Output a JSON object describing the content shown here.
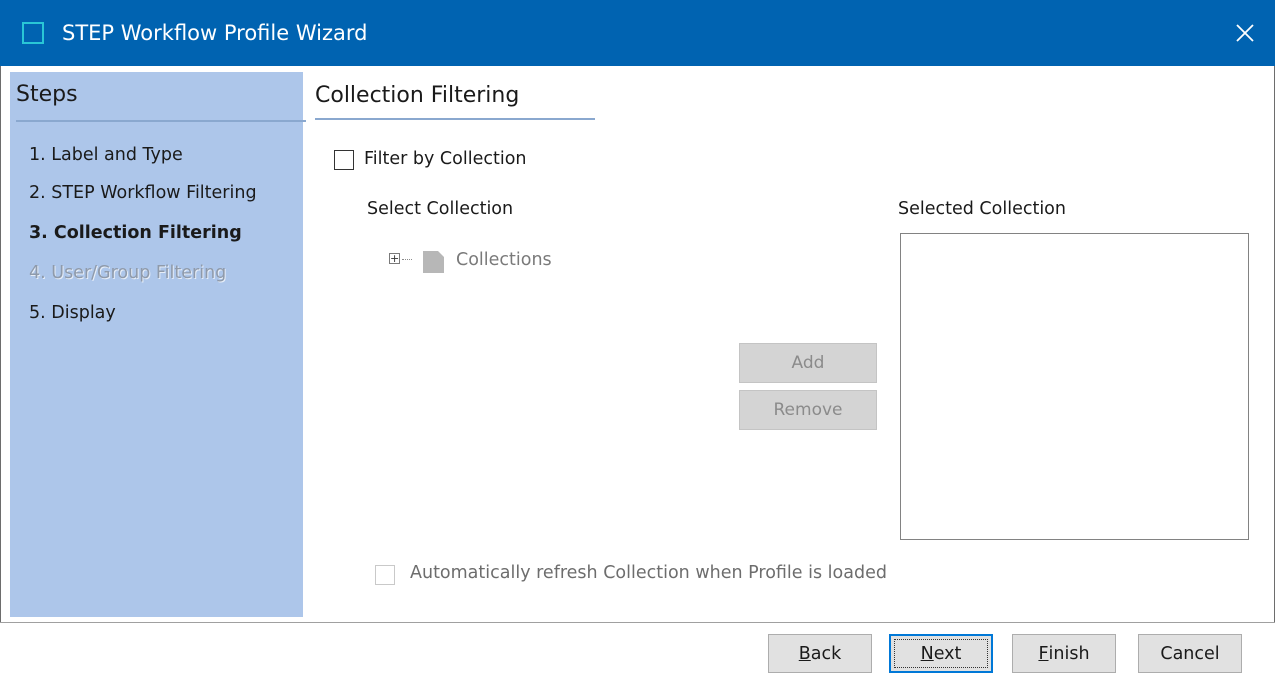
{
  "window": {
    "title": "STEP Workflow Profile Wizard",
    "close_icon": "close-icon",
    "title_icon": "app-window-icon"
  },
  "steps": {
    "heading": "Steps",
    "items": [
      {
        "label": "1. Label and Type",
        "state": "normal"
      },
      {
        "label": "2. STEP Workflow Filtering",
        "state": "normal"
      },
      {
        "label": "3. Collection Filtering",
        "state": "current"
      },
      {
        "label": "4. User/Group Filtering",
        "state": "disabled"
      },
      {
        "label": "5. Display",
        "state": "normal"
      }
    ]
  },
  "content": {
    "heading": "Collection Filtering",
    "filter_checkbox": {
      "label": "Filter by Collection",
      "checked": false
    },
    "select_collection_label": "Select Collection",
    "selected_collection_label": "Selected Collection",
    "tree": {
      "root_label": "Collections",
      "expanded": false,
      "icon": "folder-icon"
    },
    "add_button": "Add",
    "remove_button": "Remove",
    "auto_refresh_checkbox": {
      "label": "Automatically refresh Collection when Profile is loaded",
      "checked": false,
      "enabled": false
    }
  },
  "footer": {
    "back": {
      "mnemonic": "B",
      "rest": "ack"
    },
    "next": {
      "mnemonic": "N",
      "rest": "ext"
    },
    "finish": {
      "mnemonic": "F",
      "rest": "inish"
    },
    "cancel": "Cancel"
  },
  "colors": {
    "titlebar": "#0063b1",
    "steps_panel": "#adc6ea",
    "default_button_border": "#0078d7"
  }
}
